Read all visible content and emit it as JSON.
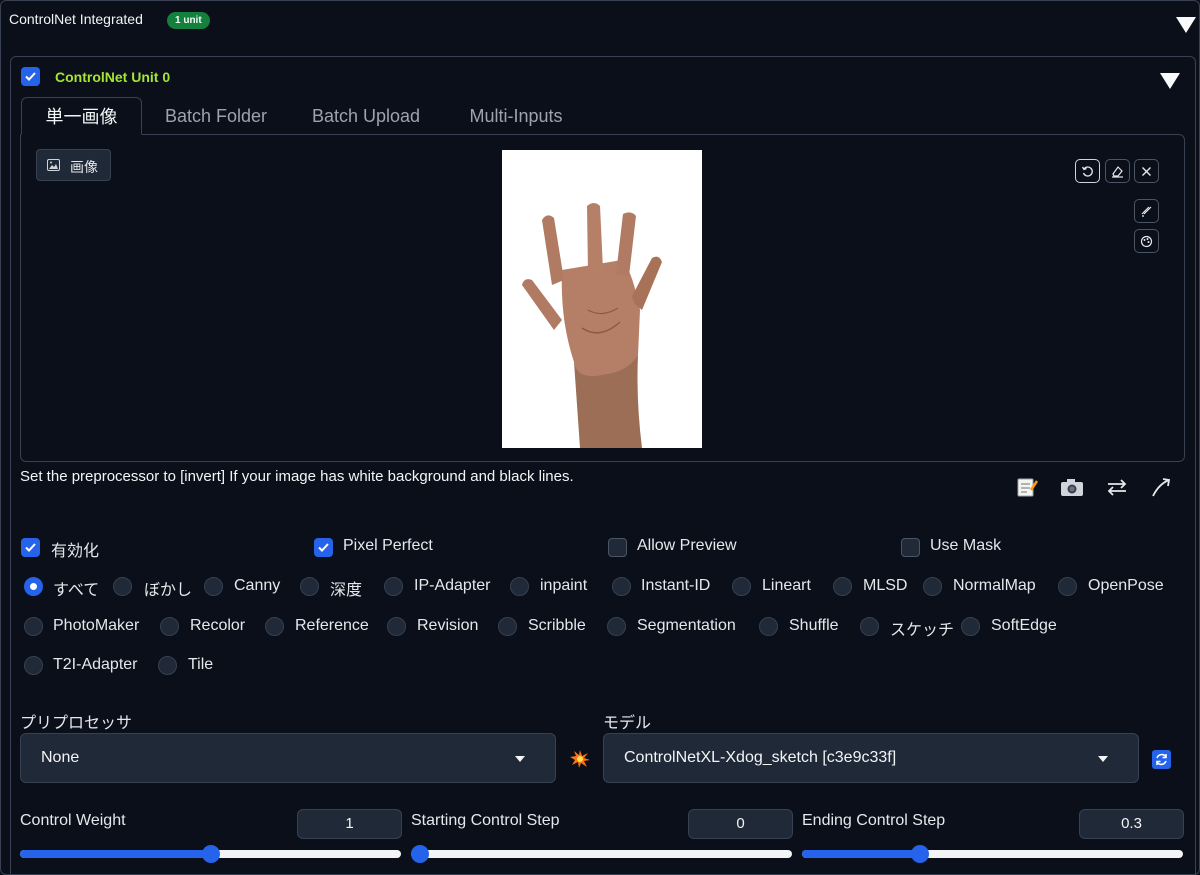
{
  "header": {
    "title": "ControlNet Integrated",
    "badge": "1 unit"
  },
  "unit": {
    "title": "ControlNet Unit 0",
    "enabled": true
  },
  "tabs": [
    {
      "label": "単一画像",
      "active": true
    },
    {
      "label": "Batch Folder",
      "active": false
    },
    {
      "label": "Batch Upload",
      "active": false
    },
    {
      "label": "Multi-Inputs",
      "active": false
    }
  ],
  "image_panel": {
    "label": "画像"
  },
  "hint": "Set the preprocessor to [invert] If your image has white background and black lines.",
  "options": {
    "enable": {
      "label": "有効化",
      "checked": true
    },
    "pixel_perfect": {
      "label": "Pixel Perfect",
      "checked": true
    },
    "allow_preview": {
      "label": "Allow Preview",
      "checked": false
    },
    "use_mask": {
      "label": "Use Mask",
      "checked": false
    }
  },
  "control_types": {
    "selected": "すべて",
    "items": [
      "すべて",
      "ぼかし",
      "Canny",
      "深度",
      "IP-Adapter",
      "inpaint",
      "Instant-ID",
      "Lineart",
      "MLSD",
      "NormalMap",
      "OpenPose",
      "PhotoMaker",
      "Recolor",
      "Reference",
      "Revision",
      "Scribble",
      "Segmentation",
      "Shuffle",
      "スケッチ",
      "SoftEdge",
      "T2I-Adapter",
      "Tile"
    ]
  },
  "preprocessor": {
    "label": "プリプロセッサ",
    "value": "None"
  },
  "model": {
    "label": "モデル",
    "value": "ControlNetXL-Xdog_sketch [c3e9c33f]"
  },
  "sliders": {
    "control_weight": {
      "label": "Control Weight",
      "value": "1",
      "min": 0,
      "max": 2
    },
    "starting_step": {
      "label": "Starting Control Step",
      "value": "0",
      "min": 0,
      "max": 1
    },
    "ending_step": {
      "label": "Ending Control Step",
      "value": "0.3",
      "min": 0,
      "max": 1
    }
  },
  "colors": {
    "accent": "#2563eb",
    "badge": "#15803d",
    "unit_title": "#a3e635",
    "background": "#0b0f19"
  }
}
